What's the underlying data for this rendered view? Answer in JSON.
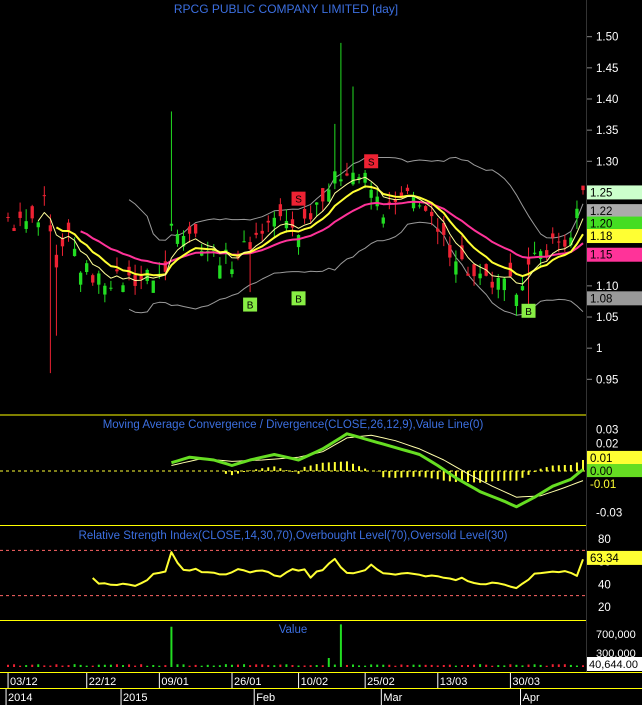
{
  "colors": {
    "background": "#000000",
    "frame": "#ffff00",
    "title": "#3c6fe0",
    "up_candle": "#22dd22",
    "down_candle": "#ee2233",
    "bollinger": "#9a9a9a",
    "ema_fast": "#ffff33",
    "ema_slow": "#ff3399",
    "macd_line": "#66dd22",
    "signal_line": "#ffffaa",
    "histogram": "#ffff33",
    "rsi_line": "#ffff33",
    "volume_up": "#22dd22",
    "volume_down": "#ee2233",
    "buy_marker": "#88ee44",
    "sell_marker": "#ee2233"
  },
  "chart_data": [
    {
      "type": "line",
      "title": "RPCG PUBLIC COMPANY LIMITED [day]",
      "ylim": [
        0.92,
        1.53
      ],
      "y_ticks": [
        "1.50",
        "1.45",
        "1.40",
        "1.35",
        "1.30",
        "1.25",
        "1.20",
        "1.15",
        "1.10",
        "1.05",
        "1",
        "0.95"
      ],
      "price_labels": [
        {
          "text": "1.25",
          "value": 1.25,
          "bg": "#ccffcc",
          "fg": "#000000"
        },
        {
          "text": "1.22",
          "value": 1.22,
          "bg": "#aaaaaa",
          "fg": "#000000"
        },
        {
          "text": "1.20",
          "value": 1.2,
          "bg": "#44dd22",
          "fg": "#000000"
        },
        {
          "text": "1.18",
          "value": 1.18,
          "bg": "#ffff33",
          "fg": "#000000"
        },
        {
          "text": "1.15",
          "value": 1.15,
          "bg": "#ff3399",
          "fg": "#000000"
        },
        {
          "text": "1.08",
          "value": 1.08,
          "bg": "#999999",
          "fg": "#000000"
        }
      ],
      "signals": [
        {
          "type": "S",
          "x": 48,
          "y": 1.24
        },
        {
          "type": "S",
          "x": 60,
          "y": 1.3
        },
        {
          "type": "B",
          "x": 40,
          "y": 1.07
        },
        {
          "type": "B",
          "x": 48,
          "y": 1.08
        },
        {
          "type": "B",
          "x": 86,
          "y": 1.06
        }
      ]
    },
    {
      "type": "line",
      "title": "Moving Average Convergence / Divergence(CLOSE,26,12,9),Value Line(0)",
      "ylim": [
        -0.037,
        0.037
      ],
      "y_ticks": [
        "0.03",
        "0.02",
        "-0.01",
        "-0.03"
      ],
      "value_labels": [
        {
          "text": "0.01",
          "value": 0.0095,
          "bg": "#ffff33",
          "fg": "#000000"
        },
        {
          "text": "0.00",
          "value": 0.0,
          "bg": "#66dd22",
          "fg": "#000000"
        },
        {
          "text": "-0.01",
          "value": -0.0095,
          "bg": "#000000",
          "fg": "#ffff33"
        }
      ]
    },
    {
      "type": "line",
      "title": "Relative Strength Index(CLOSE,14,30,70),Overbought Level(70),Oversold Level(30)",
      "ylim": [
        12,
        88
      ],
      "y_ticks": [
        "80",
        "60",
        "40",
        "20"
      ],
      "levels": [
        70,
        30
      ],
      "value_labels": [
        {
          "text": "63.34",
          "value": 63.34,
          "bg": "#ffff33",
          "fg": "#000000"
        }
      ]
    },
    {
      "type": "bar",
      "title": "Value",
      "ylim": [
        0,
        950000
      ],
      "y_ticks": [
        "700,000",
        "300,000"
      ],
      "value_labels": [
        {
          "text": "40,644.00",
          "value": 40644,
          "bg": "#ffffff",
          "fg": "#000000"
        }
      ]
    }
  ],
  "x_axis": {
    "day_labels": [
      {
        "text": "03/12",
        "i": 1
      },
      {
        "text": "22/12",
        "i": 14
      },
      {
        "text": "09/01",
        "i": 26
      },
      {
        "text": "26/01",
        "i": 38
      },
      {
        "text": "10/02",
        "i": 49
      },
      {
        "text": "25/02",
        "i": 60
      },
      {
        "text": "13/03",
        "i": 72
      },
      {
        "text": "30/03",
        "i": 84
      }
    ],
    "period_labels": [
      {
        "text": "2014",
        "i": 1
      },
      {
        "text": "2015",
        "i": 20
      },
      {
        "text": "Feb",
        "i": 42
      },
      {
        "text": "Mar",
        "i": 63
      },
      {
        "text": "Apr",
        "i": 86
      }
    ]
  },
  "series": {
    "n": 96,
    "price_keys": [
      [
        0,
        1.2
      ],
      [
        5,
        1.2
      ],
      [
        6,
        1.23
      ],
      [
        8,
        1.12
      ],
      [
        10,
        1.18
      ],
      [
        12,
        1.13
      ],
      [
        15,
        1.11
      ],
      [
        20,
        1.11
      ],
      [
        26,
        1.12
      ],
      [
        27,
        1.2
      ],
      [
        30,
        1.19
      ],
      [
        34,
        1.15
      ],
      [
        37,
        1.14
      ],
      [
        40,
        1.17
      ],
      [
        44,
        1.21
      ],
      [
        48,
        1.19
      ],
      [
        52,
        1.25
      ],
      [
        56,
        1.29
      ],
      [
        59,
        1.27
      ],
      [
        62,
        1.22
      ],
      [
        66,
        1.24
      ],
      [
        68,
        1.24
      ],
      [
        71,
        1.18
      ],
      [
        74,
        1.15
      ],
      [
        77,
        1.11
      ],
      [
        81,
        1.1
      ],
      [
        84,
        1.1
      ],
      [
        87,
        1.14
      ],
      [
        90,
        1.17
      ],
      [
        93,
        1.17
      ],
      [
        95,
        1.25
      ]
    ],
    "macd_keys": [
      [
        27,
        0.006
      ],
      [
        30,
        0.01
      ],
      [
        34,
        0.008
      ],
      [
        37,
        0.004
      ],
      [
        40,
        0.008
      ],
      [
        44,
        0.012
      ],
      [
        48,
        0.008
      ],
      [
        52,
        0.016
      ],
      [
        56,
        0.027
      ],
      [
        60,
        0.022
      ],
      [
        64,
        0.017
      ],
      [
        68,
        0.012
      ],
      [
        71,
        0.004
      ],
      [
        74,
        -0.005
      ],
      [
        78,
        -0.015
      ],
      [
        82,
        -0.022
      ],
      [
        84,
        -0.026
      ],
      [
        87,
        -0.019
      ],
      [
        90,
        -0.011
      ],
      [
        93,
        -0.006
      ],
      [
        95,
        0.001
      ]
    ],
    "signal_keys": [
      [
        27,
        0.004
      ],
      [
        32,
        0.009
      ],
      [
        37,
        0.007
      ],
      [
        42,
        0.008
      ],
      [
        48,
        0.01
      ],
      [
        52,
        0.014
      ],
      [
        56,
        0.024
      ],
      [
        60,
        0.026
      ],
      [
        64,
        0.022
      ],
      [
        68,
        0.016
      ],
      [
        72,
        0.008
      ],
      [
        76,
        -0.002
      ],
      [
        80,
        -0.011
      ],
      [
        84,
        -0.019
      ],
      [
        88,
        -0.018
      ],
      [
        92,
        -0.012
      ],
      [
        95,
        -0.007
      ]
    ],
    "rsi_keys": [
      [
        14,
        45
      ],
      [
        15,
        40
      ],
      [
        19,
        40
      ],
      [
        21,
        39
      ],
      [
        24,
        48
      ],
      [
        26,
        52
      ],
      [
        27,
        67
      ],
      [
        29,
        54
      ],
      [
        33,
        51
      ],
      [
        36,
        48
      ],
      [
        38,
        52
      ],
      [
        42,
        51
      ],
      [
        45,
        48
      ],
      [
        47,
        52
      ],
      [
        49,
        54
      ],
      [
        50,
        46
      ],
      [
        52,
        54
      ],
      [
        54,
        62
      ],
      [
        56,
        49
      ],
      [
        58,
        51
      ],
      [
        60,
        56
      ],
      [
        62,
        49
      ],
      [
        66,
        51
      ],
      [
        69,
        48
      ],
      [
        72,
        45
      ],
      [
        75,
        45
      ],
      [
        78,
        41
      ],
      [
        81,
        40
      ],
      [
        84,
        38
      ],
      [
        87,
        49
      ],
      [
        90,
        51
      ],
      [
        93,
        50
      ],
      [
        94,
        48
      ],
      [
        95,
        63.34
      ]
    ],
    "volume_spikes": [
      [
        27,
        850000
      ],
      [
        53,
        190000
      ],
      [
        55,
        900000
      ]
    ]
  }
}
